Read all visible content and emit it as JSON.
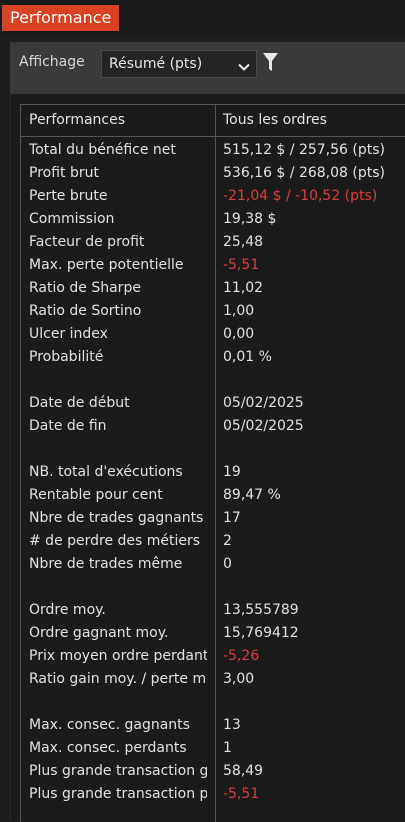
{
  "window": {
    "title": "Performance"
  },
  "toolbar": {
    "display_label": "Affichage",
    "display_value": "Résumé (pts)"
  },
  "table": {
    "headers": [
      "Performances",
      "Tous les ordres"
    ],
    "rows": [
      {
        "key": "Total du bénéfice net",
        "value": "515,12 $ / 257,56 (pts)",
        "negative": false
      },
      {
        "key": "Profit brut",
        "value": "536,16 $ / 268,08 (pts)",
        "negative": false
      },
      {
        "key": "Perte brute",
        "value": "-21,04 $ / -10,52 (pts)",
        "negative": true
      },
      {
        "key": "Commission",
        "value": "19,38 $",
        "negative": false
      },
      {
        "key": "Facteur de profit",
        "value": "25,48",
        "negative": false
      },
      {
        "key": "Max. perte potentielle",
        "value": "-5,51",
        "negative": true
      },
      {
        "key": "Ratio de Sharpe",
        "value": "11,02",
        "negative": false
      },
      {
        "key": "Ratio de Sortino",
        "value": "1,00",
        "negative": false
      },
      {
        "key": "Ulcer index",
        "value": "0,00",
        "negative": false
      },
      {
        "key": "Probabilité",
        "value": "0,01 %",
        "negative": false
      },
      {
        "key": "",
        "value": "",
        "negative": false
      },
      {
        "key": "Date de début",
        "value": "05/02/2025",
        "negative": false
      },
      {
        "key": "Date de fin",
        "value": "05/02/2025",
        "negative": false
      },
      {
        "key": "",
        "value": "",
        "negative": false
      },
      {
        "key": "NB. total d'exécutions",
        "value": "19",
        "negative": false
      },
      {
        "key": "Rentable pour cent",
        "value": "89,47 %",
        "negative": false
      },
      {
        "key": "Nbre de trades gagnants",
        "value": "17",
        "negative": false
      },
      {
        "key": "# de perdre des métiers",
        "value": "2",
        "negative": false
      },
      {
        "key": "Nbre de trades même",
        "value": "0",
        "negative": false
      },
      {
        "key": "",
        "value": "",
        "negative": false
      },
      {
        "key": "Ordre moy.",
        "value": "13,555789",
        "negative": false
      },
      {
        "key": "Ordre gagnant moy.",
        "value": "15,769412",
        "negative": false
      },
      {
        "key": "Prix moyen ordre perdant",
        "value": "-5,26",
        "negative": true
      },
      {
        "key": "Ratio gain moy. / perte moy.",
        "value": "3,00",
        "negative": false
      },
      {
        "key": "",
        "value": "",
        "negative": false
      },
      {
        "key": "Max. consec. gagnants",
        "value": "13",
        "negative": false
      },
      {
        "key": "Max. consec. perdants",
        "value": "1",
        "negative": false
      },
      {
        "key": "Plus grande transaction gagnante",
        "value": "58,49",
        "negative": false
      },
      {
        "key": "Plus grande transaction perdante",
        "value": "-5,51",
        "negative": true
      }
    ]
  },
  "colors": {
    "accent": "#d94122",
    "negative": "#e03b3b"
  },
  "icons": {
    "dropdown": "chevron-down-icon",
    "filter": "filter-icon"
  }
}
